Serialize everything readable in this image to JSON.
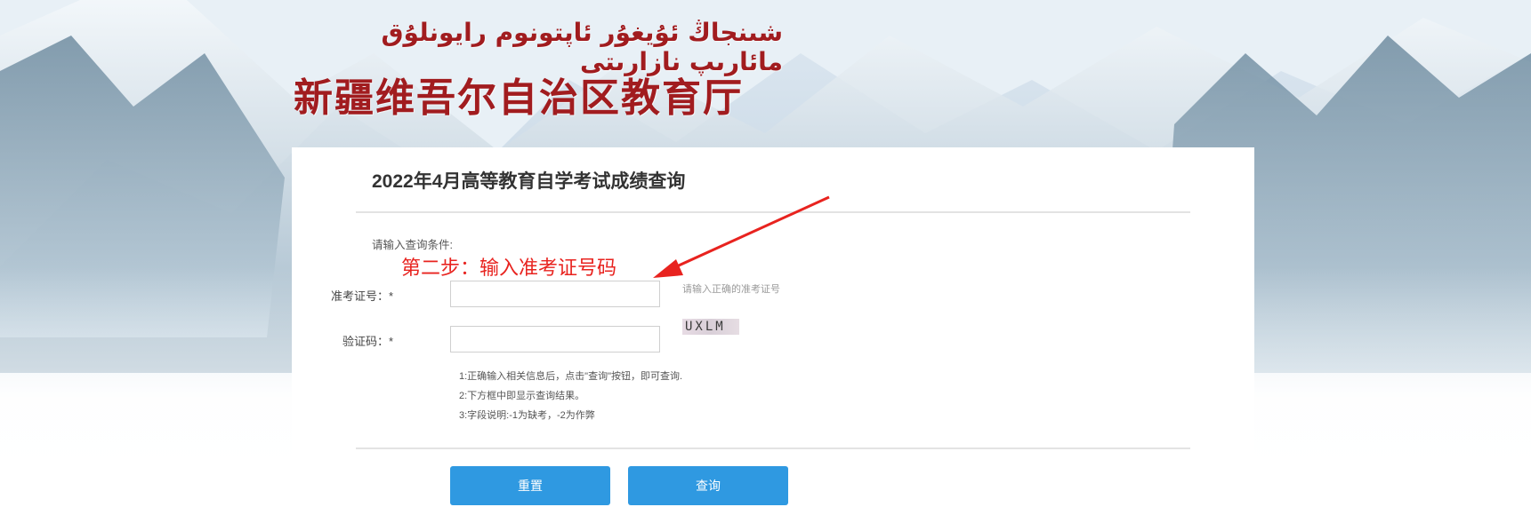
{
  "header": {
    "uyghur_title": "شىنجاڭ ئۇيغۇر ئاپتونوم رايونلۇق مائارىپ نازارىتى",
    "chinese_title": "新疆维吾尔自治区教育厅"
  },
  "page": {
    "title": "2022年4月高等教育自学考试成绩查询",
    "prompt": "请输入查询条件:",
    "annotation": "第二步：输入准考证号码"
  },
  "form": {
    "ticket_label": "准考证号：*",
    "ticket_value": "",
    "ticket_hint": "请输入正确的准考证号",
    "captcha_label": "验证码：*",
    "captcha_value": "",
    "captcha_image_text": "UXLM"
  },
  "notes": [
    "1:正确输入相关信息后，点击\"查询\"按钮，即可查询.",
    "2:下方框中即显示查询结果。",
    "3:字段说明:-1为缺考，-2为作弊"
  ],
  "buttons": {
    "reset": "重置",
    "query": "查询"
  },
  "colors": {
    "header_red": "#a11c1f",
    "annotation_red": "#e8231f",
    "button_blue": "#2f99e1"
  }
}
